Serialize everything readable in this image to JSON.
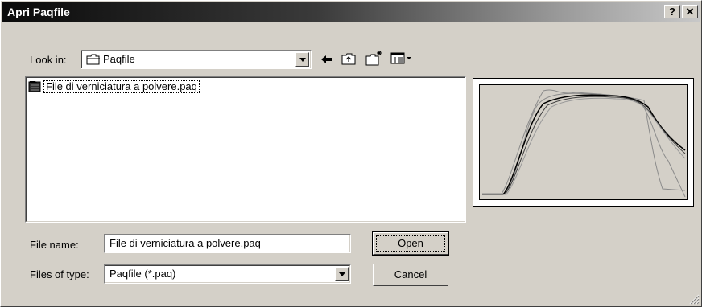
{
  "window": {
    "title": "Apri Paqfile",
    "help_button": "?",
    "close_button": "✕"
  },
  "look_in": {
    "label": "Look in:",
    "value": "Paqfile"
  },
  "files": [
    {
      "name": "File di verniciatura a polvere.paq"
    }
  ],
  "file_name": {
    "label": "File name:",
    "value": "File di verniciatura a polvere.paq"
  },
  "file_type": {
    "label": "Files of type:",
    "value": "Paqfile (*.paq)"
  },
  "buttons": {
    "open": "Open",
    "cancel": "Cancel"
  },
  "icons": [
    "back-arrow-icon",
    "up-folder-icon",
    "new-folder-icon",
    "view-menu-icon",
    "folder-icon",
    "file-icon",
    "resize-grip-icon"
  ],
  "colors": {
    "face": "#d4d0c8",
    "title_dark": "#0a0a0a",
    "title_light": "#c8c8c8"
  }
}
